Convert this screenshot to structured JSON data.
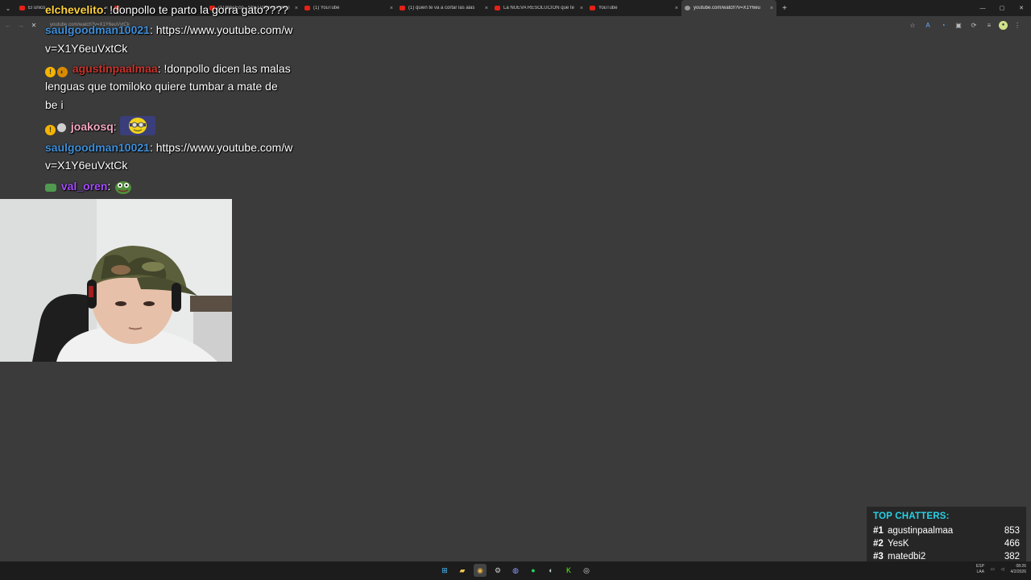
{
  "browser": {
    "tabs": [
      {
        "title": "El único...",
        "active": false
      },
      {
        "title": "",
        "active": false
      },
      {
        "title": "",
        "active": false
      },
      {
        "title": "(1) Boy Eco - Sky I (official video)",
        "active": false
      },
      {
        "title": "(1) YouTube",
        "active": false
      },
      {
        "title": "(1) quien te va a cortar las alas",
        "active": false
      },
      {
        "title": "La NUEVA RESOLUCIÓN que te",
        "active": false
      },
      {
        "title": "YouTube",
        "active": false
      },
      {
        "title": "youtube.com/watch?v=X1Y6eu",
        "active": true
      }
    ],
    "url": "youtube.com/watch?v=X1Y6euVxtCk",
    "new_tab": "+",
    "close_glyph": "×"
  },
  "chat": [
    {
      "user": "elchevelito",
      "user_color": "#ffd23f",
      "text": ": !donpollo te parto la gorra gato????"
    },
    {
      "user": "saulgoodman10021",
      "user_color": "#3f8fd9",
      "text": ": https://www.youtube.com/watch?v=X1Y6euVxtCk"
    },
    {
      "user": "agustinpaalmaa",
      "user_color": "#c9342a",
      "text": ": !donpollo dicen las malas lenguas que tomiloko quiere tumbar a mate de be i"
    },
    {
      "user": "joakosq",
      "user_color": "#f4a6c2",
      "text": ":"
    },
    {
      "user": "saulgoodman10021",
      "user_color": "#3f8fd9",
      "text": ": https://www.youtube.com/watch?v=X1Y6euVxtCk"
    },
    {
      "user": "val_oren",
      "user_color": "#a64dff",
      "text": ":"
    }
  ],
  "chat_lines": {
    "m0": "elchevelito",
    "m0t": ": !donpollo te parto la gorra gato????",
    "m1": "saulgoodman10021",
    "m1t": ": https://www.youtube.com/w",
    "m1t2": "v=X1Y6euVxtCk",
    "m2": "agustinpaalmaa",
    "m2t": ": !donpollo dicen las malas",
    "m2t2": "lenguas que tomiloko quiere tumbar a mate de",
    "m2t3": "be i",
    "m3": "joakosq",
    "m3t": ":",
    "m4": "saulgoodman10021",
    "m4t": ": https://www.youtube.com/w",
    "m4t2": "v=X1Y6euVxtCk",
    "m5": "val_oren",
    "m5t": ":"
  },
  "top_chatters": {
    "title": "TOP CHATTERS:",
    "rows": [
      {
        "rank": "#1",
        "name": "agustinpaalmaa",
        "count": "853"
      },
      {
        "rank": "#2",
        "name": "YesK",
        "count": "466"
      },
      {
        "rank": "#3",
        "name": "matedbi2",
        "count": "382"
      }
    ]
  },
  "taskbar": {
    "lang_top": "ESP",
    "lang_bottom": "LAA",
    "time": "08:26",
    "date": "4/2/2026"
  },
  "colors": {
    "background": "#3b3b3b",
    "top_chatters_title": "#27d1e6"
  }
}
